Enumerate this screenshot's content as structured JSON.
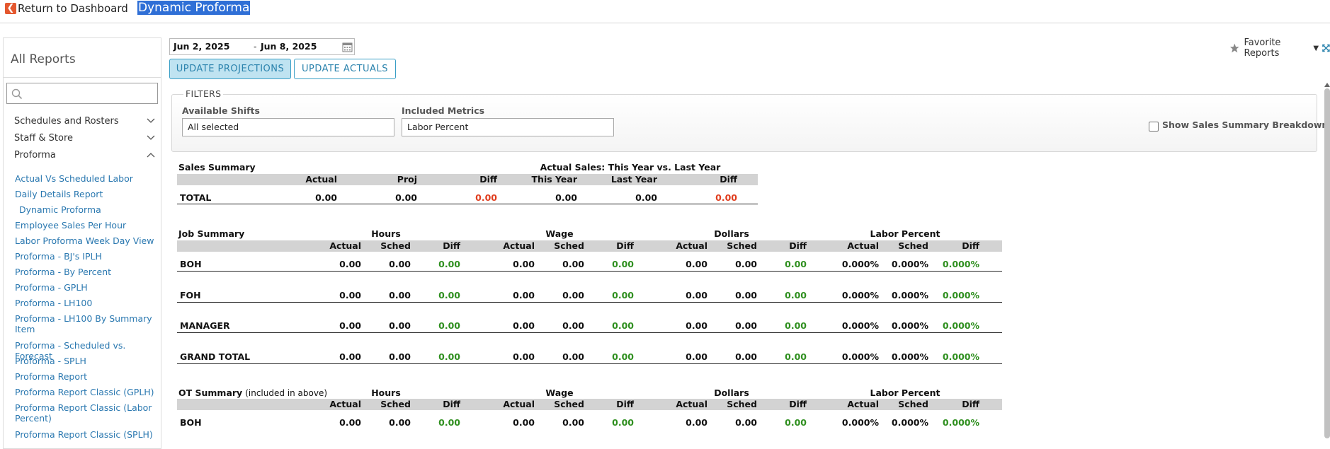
{
  "topbar": {
    "back_label": "Return to Dashboard",
    "page_title": "Dynamic Proforma"
  },
  "sidebar": {
    "title": "All Reports",
    "search_placeholder": "",
    "categories": [
      {
        "label": "Schedules and Rosters",
        "expanded": false
      },
      {
        "label": "Staff & Store",
        "expanded": false
      },
      {
        "label": "Proforma",
        "expanded": true
      }
    ],
    "links": [
      "Actual Vs Scheduled Labor",
      "Daily Details Report",
      "Dynamic Proforma",
      "Employee Sales Per Hour",
      "Labor Proforma Week Day View",
      "Proforma - BJ's IPLH",
      "Proforma - By Percent",
      "Proforma - GPLH",
      "Proforma - LH100",
      "Proforma - LH100 By Summary Item",
      "Proforma - Scheduled vs. Forecast",
      "Proforma - SPLH",
      "Proforma Report",
      "Proforma Report Classic (GPLH)",
      "Proforma Report Classic (Labor Percent)",
      "Proforma Report Classic (SPLH)"
    ]
  },
  "dates": {
    "start": "Jun 2, 2025",
    "sep": "-",
    "end": "Jun 8, 2025"
  },
  "buttons": {
    "update_projections": "UPDATE PROJECTIONS",
    "update_actuals": "UPDATE ACTUALS"
  },
  "favorites": {
    "label": "Favorite Reports"
  },
  "filters": {
    "legend": "FILTERS",
    "shifts_label": "Available Shifts",
    "shifts_value": "All selected",
    "metrics_label": "Included Metrics",
    "metrics_value": "Labor Percent",
    "breakdown_label": "Show Sales Summary Breakdown"
  },
  "sales_summary": {
    "title": "Sales Summary",
    "group": "Actual Sales: This Year vs. Last Year",
    "columns": [
      "Actual",
      "Proj",
      "Diff",
      "This Year",
      "Last Year",
      "Diff"
    ],
    "row_label": "TOTAL",
    "values": [
      "0.00",
      "0.00",
      "0.00",
      "0.00",
      "0.00",
      "0.00"
    ]
  },
  "job_summary": {
    "title": "Job Summary",
    "groups": [
      "Hours",
      "Wage",
      "Dollars",
      "Labor Percent"
    ],
    "subcols": [
      "Actual",
      "Sched",
      "Diff"
    ],
    "rows": [
      {
        "label": "BOH",
        "values": [
          "0.00",
          "0.00",
          "0.00",
          "0.00",
          "0.00",
          "0.00",
          "0.00",
          "0.00",
          "0.00",
          "0.000%",
          "0.000%",
          "0.000%"
        ]
      },
      {
        "label": "FOH",
        "values": [
          "0.00",
          "0.00",
          "0.00",
          "0.00",
          "0.00",
          "0.00",
          "0.00",
          "0.00",
          "0.00",
          "0.000%",
          "0.000%",
          "0.000%"
        ]
      },
      {
        "label": "MANAGER",
        "values": [
          "0.00",
          "0.00",
          "0.00",
          "0.00",
          "0.00",
          "0.00",
          "0.00",
          "0.00",
          "0.00",
          "0.000%",
          "0.000%",
          "0.000%"
        ]
      },
      {
        "label": "GRAND TOTAL",
        "values": [
          "0.00",
          "0.00",
          "0.00",
          "0.00",
          "0.00",
          "0.00",
          "0.00",
          "0.00",
          "0.00",
          "0.000%",
          "0.000%",
          "0.000%"
        ]
      }
    ]
  },
  "ot_summary": {
    "title": "OT Summary",
    "note": "(included in above)",
    "groups": [
      "Hours",
      "Wage",
      "Dollars",
      "Labor Percent"
    ],
    "subcols": [
      "Actual",
      "Sched",
      "Diff"
    ],
    "rows": [
      {
        "label": "BOH",
        "values": [
          "0.00",
          "0.00",
          "0.00",
          "0.00",
          "0.00",
          "0.00",
          "0.00",
          "0.00",
          "0.00",
          "0.000%",
          "0.000%",
          "0.000%"
        ]
      }
    ]
  },
  "colors": {
    "accent": "#2b83ad",
    "diff_negative": "#e03d1e",
    "diff_positive": "#2f8f1f",
    "header_bar": "#d3d3d3"
  }
}
